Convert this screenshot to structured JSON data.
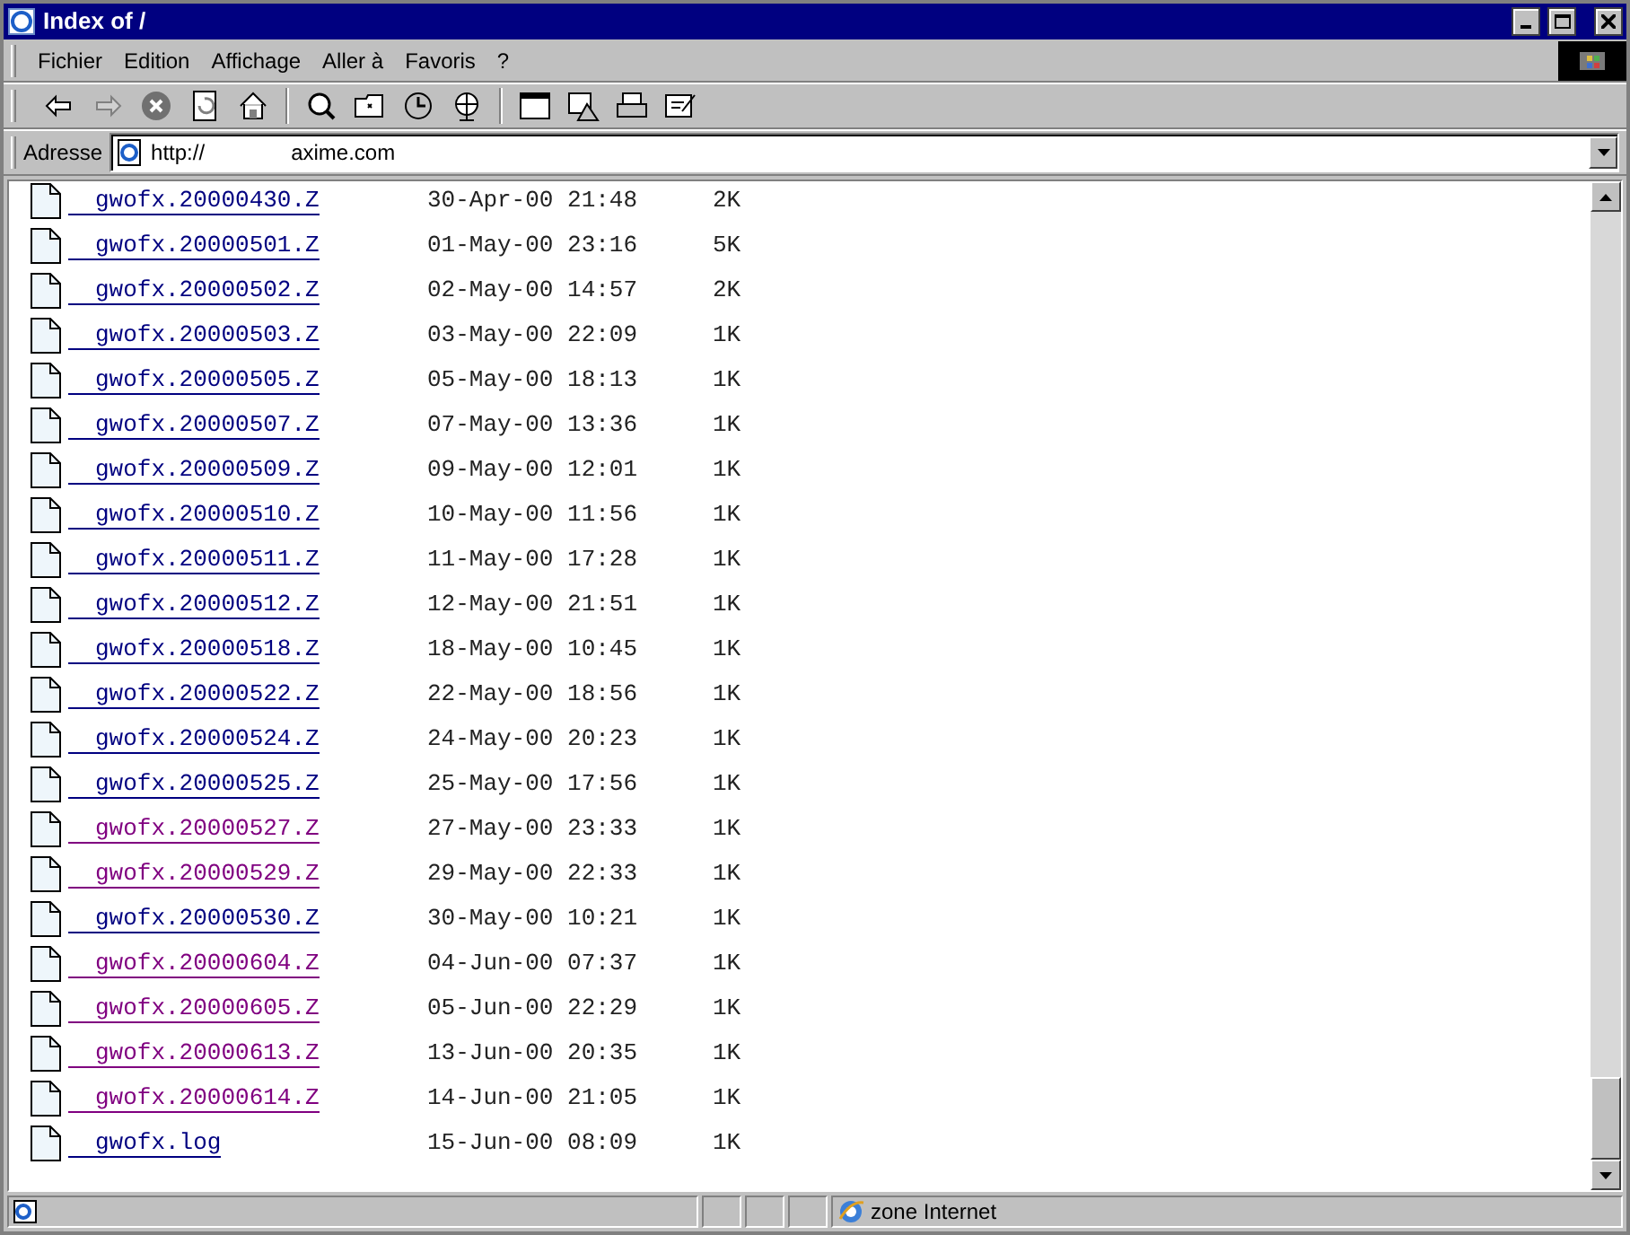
{
  "window": {
    "title": "Index of /"
  },
  "menu": [
    "Fichier",
    "Edition",
    "Affichage",
    "Aller à",
    "Favoris",
    "?"
  ],
  "address": {
    "label": "Adresse",
    "url_start": "http://",
    "url_part": "axime.com"
  },
  "files": [
    {
      "name": "gwofx.20000430.Z",
      "date": "30-Apr-00 21:48",
      "size": "2K",
      "visited": false
    },
    {
      "name": "gwofx.20000501.Z",
      "date": "01-May-00 23:16",
      "size": "5K",
      "visited": false
    },
    {
      "name": "gwofx.20000502.Z",
      "date": "02-May-00 14:57",
      "size": "2K",
      "visited": false
    },
    {
      "name": "gwofx.20000503.Z",
      "date": "03-May-00 22:09",
      "size": "1K",
      "visited": false
    },
    {
      "name": "gwofx.20000505.Z",
      "date": "05-May-00 18:13",
      "size": "1K",
      "visited": false
    },
    {
      "name": "gwofx.20000507.Z",
      "date": "07-May-00 13:36",
      "size": "1K",
      "visited": false
    },
    {
      "name": "gwofx.20000509.Z",
      "date": "09-May-00 12:01",
      "size": "1K",
      "visited": false
    },
    {
      "name": "gwofx.20000510.Z",
      "date": "10-May-00 11:56",
      "size": "1K",
      "visited": false
    },
    {
      "name": "gwofx.20000511.Z",
      "date": "11-May-00 17:28",
      "size": "1K",
      "visited": false
    },
    {
      "name": "gwofx.20000512.Z",
      "date": "12-May-00 21:51",
      "size": "1K",
      "visited": false
    },
    {
      "name": "gwofx.20000518.Z",
      "date": "18-May-00 10:45",
      "size": "1K",
      "visited": false
    },
    {
      "name": "gwofx.20000522.Z",
      "date": "22-May-00 18:56",
      "size": "1K",
      "visited": false
    },
    {
      "name": "gwofx.20000524.Z",
      "date": "24-May-00 20:23",
      "size": "1K",
      "visited": false
    },
    {
      "name": "gwofx.20000525.Z",
      "date": "25-May-00 17:56",
      "size": "1K",
      "visited": false
    },
    {
      "name": "gwofx.20000527.Z",
      "date": "27-May-00 23:33",
      "size": "1K",
      "visited": true
    },
    {
      "name": "gwofx.20000529.Z",
      "date": "29-May-00 22:33",
      "size": "1K",
      "visited": true
    },
    {
      "name": "gwofx.20000530.Z",
      "date": "30-May-00 10:21",
      "size": "1K",
      "visited": false
    },
    {
      "name": "gwofx.20000604.Z",
      "date": "04-Jun-00 07:37",
      "size": "1K",
      "visited": true
    },
    {
      "name": "gwofx.20000605.Z",
      "date": "05-Jun-00 22:29",
      "size": "1K",
      "visited": true
    },
    {
      "name": "gwofx.20000613.Z",
      "date": "13-Jun-00 20:35",
      "size": "1K",
      "visited": true
    },
    {
      "name": "gwofx.20000614.Z",
      "date": "14-Jun-00 21:05",
      "size": "1K",
      "visited": true
    },
    {
      "name": "gwofx.log",
      "date": "15-Jun-00 08:09",
      "size": "1K",
      "visited": false
    }
  ],
  "status_bar": {
    "zone": "zone Internet"
  }
}
